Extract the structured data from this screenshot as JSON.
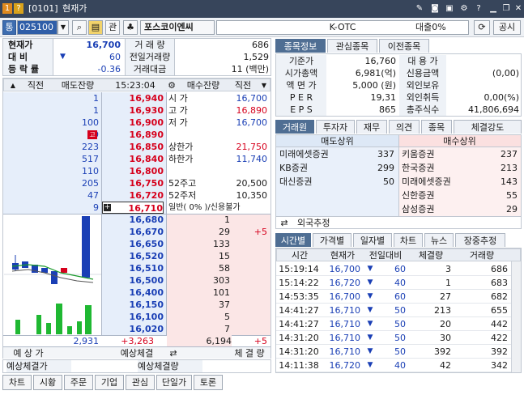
{
  "window": {
    "id": "1",
    "mark": "?",
    "code": "[0101]",
    "title": "현재가"
  },
  "toolbar": {
    "search_mode": "통",
    "stock_code": "025100",
    "dropdown": "▼",
    "gwan": "관",
    "stock_name": "포스코이엔씨",
    "market": "K-OTC",
    "loan": "대출0%",
    "notice": "공시"
  },
  "summary": {
    "labels": [
      "현재가",
      "대  비",
      "등 락 률"
    ],
    "price": "16,700",
    "change_arrow": "▼",
    "change": "60",
    "rate": "-0.36",
    "vol_label": "거 래 량",
    "vol": "686",
    "prev_vol_label": "전일거래량",
    "prev_vol": "1,529",
    "amount_label": "거래대금",
    "amount": "11 (백만)"
  },
  "orderbook": {
    "headers": [
      "직전",
      "매도잔량",
      "15:23:04",
      "매수잔량",
      "직전"
    ],
    "asks": [
      {
        "qty": "1",
        "price": "16,940",
        "label": "시  가",
        "val": "16,700",
        "color": "blue"
      },
      {
        "qty": "1",
        "price": "16,930",
        "label": "고  가",
        "val": "16,890",
        "color": "red"
      },
      {
        "qty": "100",
        "price": "16,900",
        "label": "저  가",
        "val": "16,700",
        "color": "blue"
      },
      {
        "qty": "29",
        "price": "16,890",
        "label": "",
        "val": "",
        "color": "",
        "mark": "고"
      },
      {
        "qty": "223",
        "price": "16,850",
        "label": "상한가",
        "val": "21,750",
        "color": "red"
      },
      {
        "qty": "517",
        "price": "16,840",
        "label": "하한가",
        "val": "11,740",
        "color": "blue"
      },
      {
        "qty": "110",
        "price": "16,800",
        "label": "",
        "val": "",
        "color": ""
      },
      {
        "qty": "205",
        "price": "16,750",
        "label": "52주고",
        "val": "20,500",
        "color": ""
      },
      {
        "qty": "47",
        "price": "16,720",
        "label": "52주저",
        "val": "10,350",
        "color": ""
      },
      {
        "qty": "9",
        "price": "16,710",
        "label": "일반( 0% )/신용불가",
        "val": "",
        "color": ""
      }
    ],
    "bids": [
      {
        "price": "16,680",
        "qty": "1",
        "diff": ""
      },
      {
        "price": "16,670",
        "qty": "29",
        "diff": "+5"
      },
      {
        "price": "16,650",
        "qty": "133",
        "diff": ""
      },
      {
        "price": "16,520",
        "qty": "15",
        "diff": ""
      },
      {
        "price": "16,510",
        "qty": "58",
        "diff": ""
      },
      {
        "price": "16,500",
        "qty": "303",
        "diff": ""
      },
      {
        "price": "16,400",
        "qty": "101",
        "diff": ""
      },
      {
        "price": "16,150",
        "qty": "37",
        "diff": ""
      },
      {
        "price": "16,100",
        "qty": "5",
        "diff": ""
      },
      {
        "price": "16,020",
        "qty": "7",
        "diff": ""
      }
    ],
    "total_ask": "2,931",
    "total_diff_left": "+3,263",
    "total_bid": "6,194",
    "total_diff_right": "+5",
    "footer": [
      "예 상 가",
      "예상체결",
      "체 결 량"
    ]
  },
  "expected": {
    "left": "예상체결가",
    "right": "예상체결량"
  },
  "bottom_tabs": [
    "차트",
    "시황",
    "주문",
    "기업",
    "관심",
    "단일가",
    "토론"
  ],
  "info": {
    "tabs": [
      "종목정보",
      "관심종목",
      "이전종목"
    ],
    "rows": [
      {
        "l": "기준가",
        "v": "16,760",
        "l2": "대 용 가",
        "v2": ""
      },
      {
        "l": "시가총액",
        "v": "6,981(억)",
        "l2": "신용금액",
        "v2": "(0,00)"
      },
      {
        "l": "액 면 가",
        "v": "5,000 (원)",
        "l2": "외인보유",
        "v2": ""
      },
      {
        "l": "P E R",
        "v": "19,31",
        "l2": "외인취득",
        "v2": "0,00(%)"
      },
      {
        "l": "E P S",
        "v": "865",
        "l2": "총주식수",
        "v2": "41,806,694"
      }
    ]
  },
  "broker": {
    "tabs": [
      "거래원",
      "투자자",
      "재무",
      "의견",
      "종목",
      "체결강도"
    ],
    "sell_header": "매도상위",
    "buy_header": "매수상위",
    "sells": [
      {
        "n": "미래에셋증권",
        "v": "337"
      },
      {
        "n": "KB증권",
        "v": "299"
      },
      {
        "n": "대신증권",
        "v": "50"
      }
    ],
    "buys": [
      {
        "n": "키움증권",
        "v": "237"
      },
      {
        "n": "한국증권",
        "v": "213"
      },
      {
        "n": "미래에셋증권",
        "v": "143"
      },
      {
        "n": "신한증권",
        "v": "55"
      },
      {
        "n": "삼성증권",
        "v": "29"
      }
    ],
    "foreign": "외국추정"
  },
  "ticks": {
    "tabs": [
      "시간별",
      "가격별",
      "일자별",
      "차트",
      "뉴스",
      "장중추정"
    ],
    "headers": [
      "시간",
      "현재가",
      "전일대비",
      "체결량",
      "거래량"
    ],
    "rows": [
      {
        "t": "15:19:14",
        "p": "16,700",
        "a": "▼",
        "d": "60",
        "q": "3",
        "v": "686"
      },
      {
        "t": "15:14:22",
        "p": "16,720",
        "a": "▼",
        "d": "40",
        "q": "1",
        "v": "683"
      },
      {
        "t": "14:53:35",
        "p": "16,700",
        "a": "▼",
        "d": "60",
        "q": "27",
        "v": "682"
      },
      {
        "t": "14:41:27",
        "p": "16,710",
        "a": "▼",
        "d": "50",
        "q": "213",
        "v": "655"
      },
      {
        "t": "14:41:27",
        "p": "16,710",
        "a": "▼",
        "d": "50",
        "q": "20",
        "v": "442"
      },
      {
        "t": "14:31:20",
        "p": "16,710",
        "a": "▼",
        "d": "50",
        "q": "30",
        "v": "422"
      },
      {
        "t": "14:31:20",
        "p": "16,710",
        "a": "▼",
        "d": "50",
        "q": "392",
        "v": "392"
      },
      {
        "t": "14:11:38",
        "p": "16,720",
        "a": "▼",
        "d": "40",
        "q": "42",
        "v": "342"
      }
    ]
  },
  "colors": {
    "up": "#d6001c",
    "down": "#1a3fb5",
    "titlebar": "#37455b",
    "ask_bg": "#e6eefa",
    "bid_bg": "#fbe6e6"
  }
}
